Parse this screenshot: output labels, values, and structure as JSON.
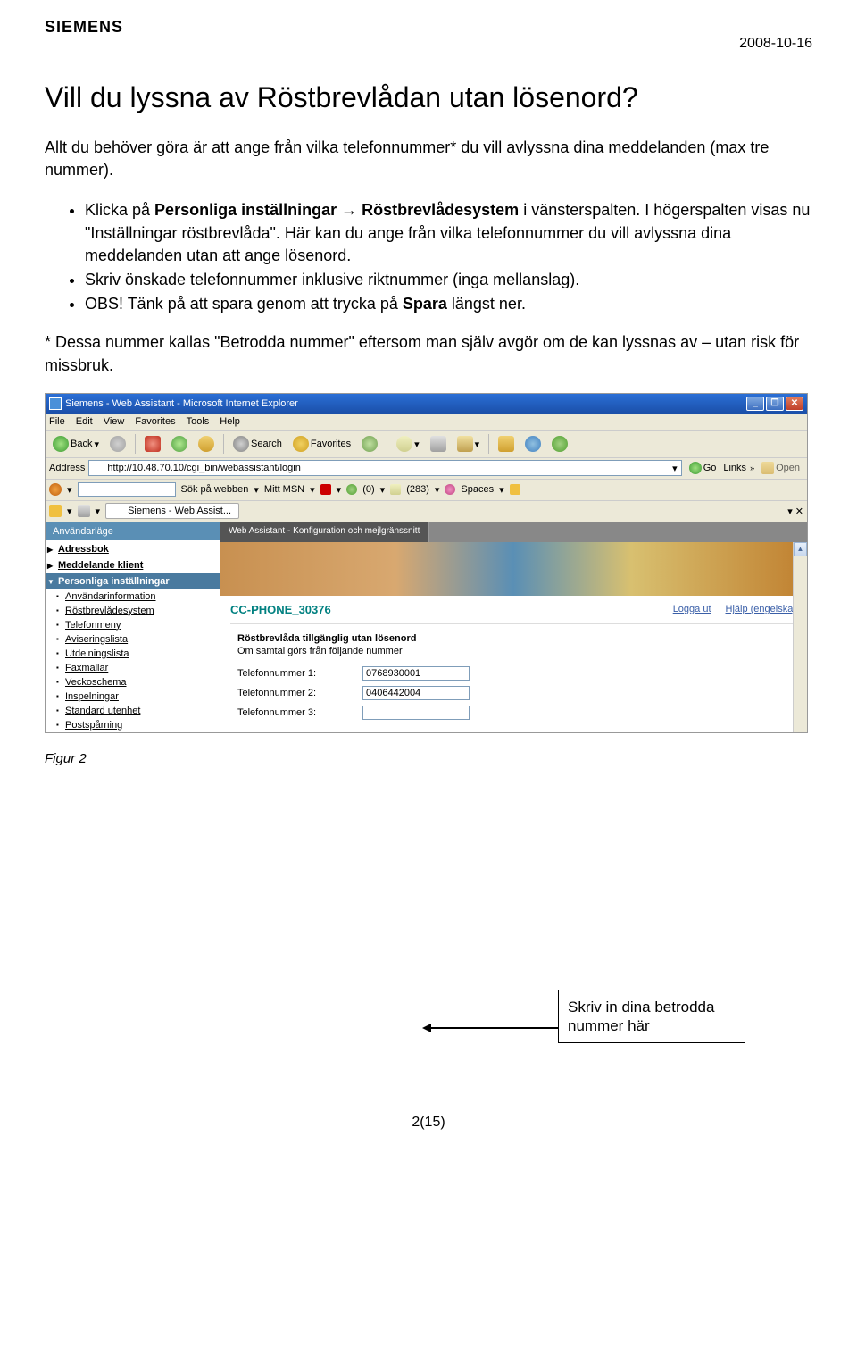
{
  "header": {
    "logo": "SIEMENS",
    "date": "2008-10-16"
  },
  "doc": {
    "heading": "Vill du lyssna av Röstbrevlådan utan lösenord?",
    "intro": "Allt du behöver göra är att ange från vilka telefonnummer* du vill avlyssna dina meddelanden (max tre nummer).",
    "b1_pre": "Klicka på ",
    "b1_bold1": "Personliga inställningar",
    "b1_mid": " → ",
    "b1_bold2": "Röstbrevlådesystem",
    "b1_post": " i vänsterspalten. I högerspalten visas nu \"Inställningar röstbrevlåda\". Här kan du ange från vilka telefonnummer du vill avlyssna dina meddelanden utan att ange lösenord.",
    "b2": "Skriv önskade telefonnummer inklusive riktnummer (inga mellanslag).",
    "b3_pre": "OBS! Tänk på att spara genom att trycka på ",
    "b3_bold": "Spara",
    "b3_post": " längst ner.",
    "footnote": "* Dessa nummer kallas \"Betrodda nummer\" eftersom man själv avgör om de kan lyssnas av – utan risk för missbruk.",
    "figure_caption": "Figur 2",
    "page_num": "2(15)"
  },
  "callout": "Skriv in dina betrodda nummer här",
  "ie": {
    "title": "Siemens - Web Assistant - Microsoft Internet Explorer",
    "menus": [
      "File",
      "Edit",
      "View",
      "Favorites",
      "Tools",
      "Help"
    ],
    "back": "Back",
    "search": "Search",
    "favorites": "Favorites",
    "address_label": "Address",
    "url": "http://10.48.70.10/cgi_bin/webassistant/login",
    "go": "Go",
    "links": "Links",
    "open": "Open",
    "msn": {
      "search_label": "Sök på webben",
      "mitt": "Mitt MSN",
      "zero": "(0)",
      "n283": "(283)",
      "spaces": "Spaces"
    },
    "tab": "Siemens - Web Assist..."
  },
  "app": {
    "mode_tab": "Användarläge",
    "nav": {
      "adressbok": "Adressbok",
      "meddelande": "Meddelande klient",
      "personliga": "Personliga inställningar",
      "subs": [
        "Användarinformation",
        "Röstbrevlådesystem",
        "Telefonmeny",
        "Aviseringslista",
        "Utdelningslista",
        "Faxmallar",
        "Veckoschema",
        "Inspelningar",
        "Standard utenhet",
        "Postspårning"
      ]
    },
    "top_tab": "Web Assistant - Konfiguration och mejlgränssnitt",
    "cc_phone": "CC-PHONE_30376",
    "logout": "Logga ut",
    "help": "Hjälp (engelska)",
    "section_title": "Röstbrevlåda tillgänglig utan lösenord",
    "section_sub": "Om samtal görs från följande nummer",
    "rows": [
      {
        "label": "Telefonnummer 1:",
        "value": "0768930001"
      },
      {
        "label": "Telefonnummer 2:",
        "value": "0406442004"
      },
      {
        "label": "Telefonnummer 3:",
        "value": ""
      }
    ]
  }
}
